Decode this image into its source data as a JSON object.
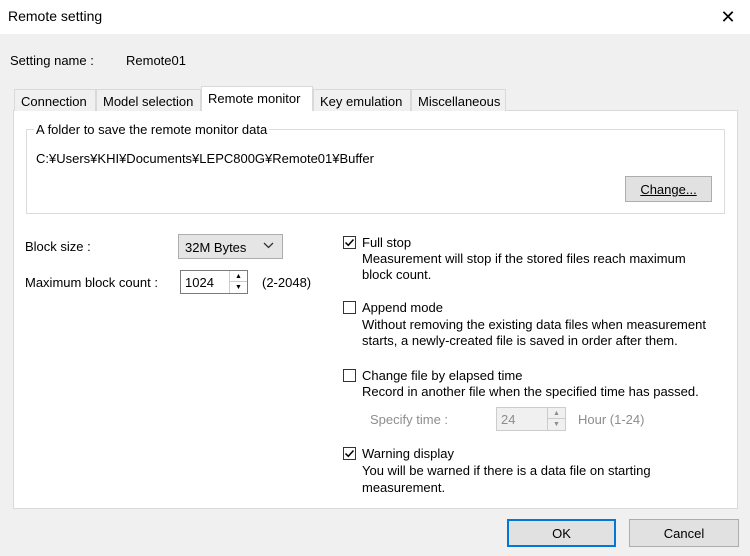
{
  "window": {
    "title": "Remote setting",
    "close_glyph": "✕"
  },
  "setting_name": {
    "label": "Setting name :",
    "value": "Remote01"
  },
  "tabs": [
    {
      "label": "Connection"
    },
    {
      "label": "Model selection"
    },
    {
      "label": "Remote monitor",
      "active": true
    },
    {
      "label": "Key emulation"
    },
    {
      "label": "Miscellaneous"
    }
  ],
  "folder": {
    "group_title": "A folder to save the remote monitor data",
    "path": "C:¥Users¥KHI¥Documents¥LEPC800G¥Remote01¥Buffer",
    "change_button": "Change..."
  },
  "block_size": {
    "label": "Block size :",
    "value": "32M Bytes"
  },
  "max_block_count": {
    "label": "Maximum block count :",
    "value": "1024",
    "range": "(2-2048)"
  },
  "options": {
    "full_stop": {
      "label": "Full stop",
      "checked": true,
      "desc1": "Measurement will stop if the stored files reach maximum",
      "desc2": "block count."
    },
    "append_mode": {
      "label": "Append mode",
      "checked": false,
      "desc1": "Without removing the existing data files when measurement",
      "desc2": "starts, a newly-created file is saved in order after them."
    },
    "change_file": {
      "label": "Change file by elapsed time",
      "checked": false,
      "desc1": "Record in another file when the specified time has passed."
    },
    "specify_time": {
      "label": "Specify time :",
      "value": "24",
      "unit": "Hour (1-24)"
    },
    "warning_display": {
      "label": "Warning display",
      "checked": true,
      "desc1": "You will be warned if there is a data file on starting",
      "desc2": "measurement."
    }
  },
  "footer": {
    "ok": "OK",
    "cancel": "Cancel"
  }
}
